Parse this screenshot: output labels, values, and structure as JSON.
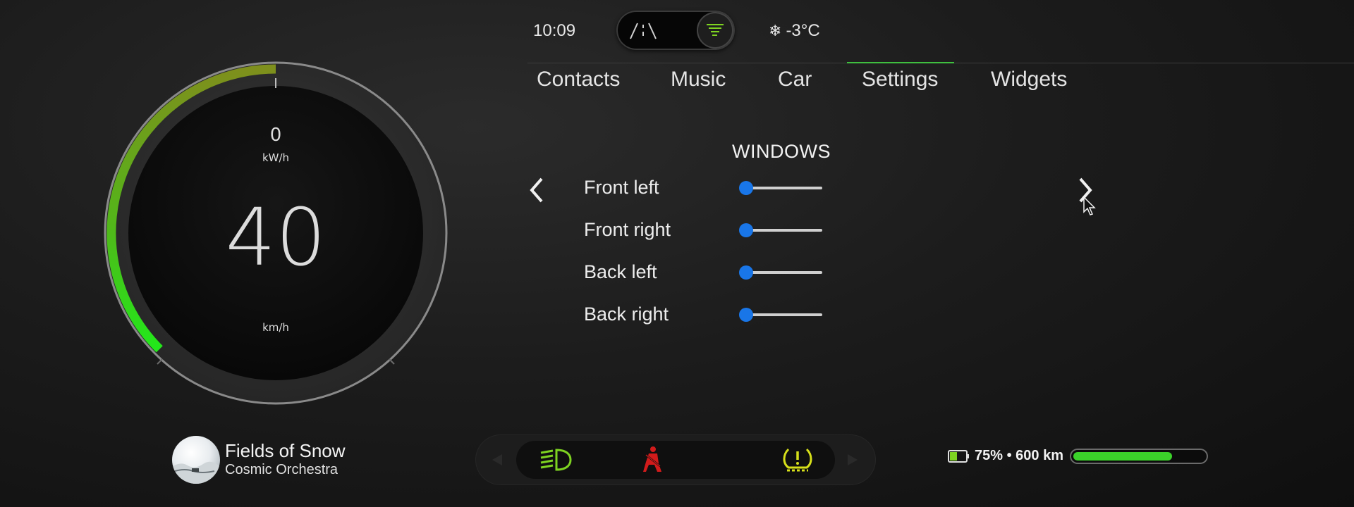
{
  "top_bar": {
    "time": "10:09",
    "temperature": "-3°C",
    "weather_icon": "snowflake-icon",
    "mode_toggle": {
      "options": [
        "road-icon",
        "list-icon"
      ],
      "active": "list-icon"
    }
  },
  "tabs": [
    {
      "label": "Contacts",
      "active": false
    },
    {
      "label": "Music",
      "active": false
    },
    {
      "label": "Car",
      "active": false
    },
    {
      "label": "Settings",
      "active": true
    },
    {
      "label": "Widgets",
      "active": false
    }
  ],
  "windows_panel": {
    "title": "WINDOWS",
    "rows": [
      {
        "label": "Front left",
        "value": 0
      },
      {
        "label": "Front right",
        "value": 0
      },
      {
        "label": "Back left",
        "value": 0
      },
      {
        "label": "Back right",
        "value": 0
      }
    ],
    "prev_icon": "chevron-left-icon",
    "next_icon": "chevron-right-icon"
  },
  "gauge": {
    "power_value": "0",
    "power_unit": "kW/h",
    "speed": "40",
    "speed_unit": "km/h",
    "arc_fraction": 0.5,
    "arc_colors": [
      "#7e8f1c",
      "#22e81a"
    ]
  },
  "now_playing": {
    "title": "Fields of Snow",
    "artist": "Cosmic Orchestra"
  },
  "indicators": [
    {
      "icon": "headlight-icon",
      "color": "#7ed321"
    },
    {
      "icon": "seatbelt-warning-icon",
      "color": "#d11b1b"
    },
    {
      "icon": "tire-pressure-warning-icon",
      "color": "#d7e01a"
    }
  ],
  "battery": {
    "range_text": "75% • 600 km",
    "percent": 75,
    "color": "#3bd22a"
  }
}
